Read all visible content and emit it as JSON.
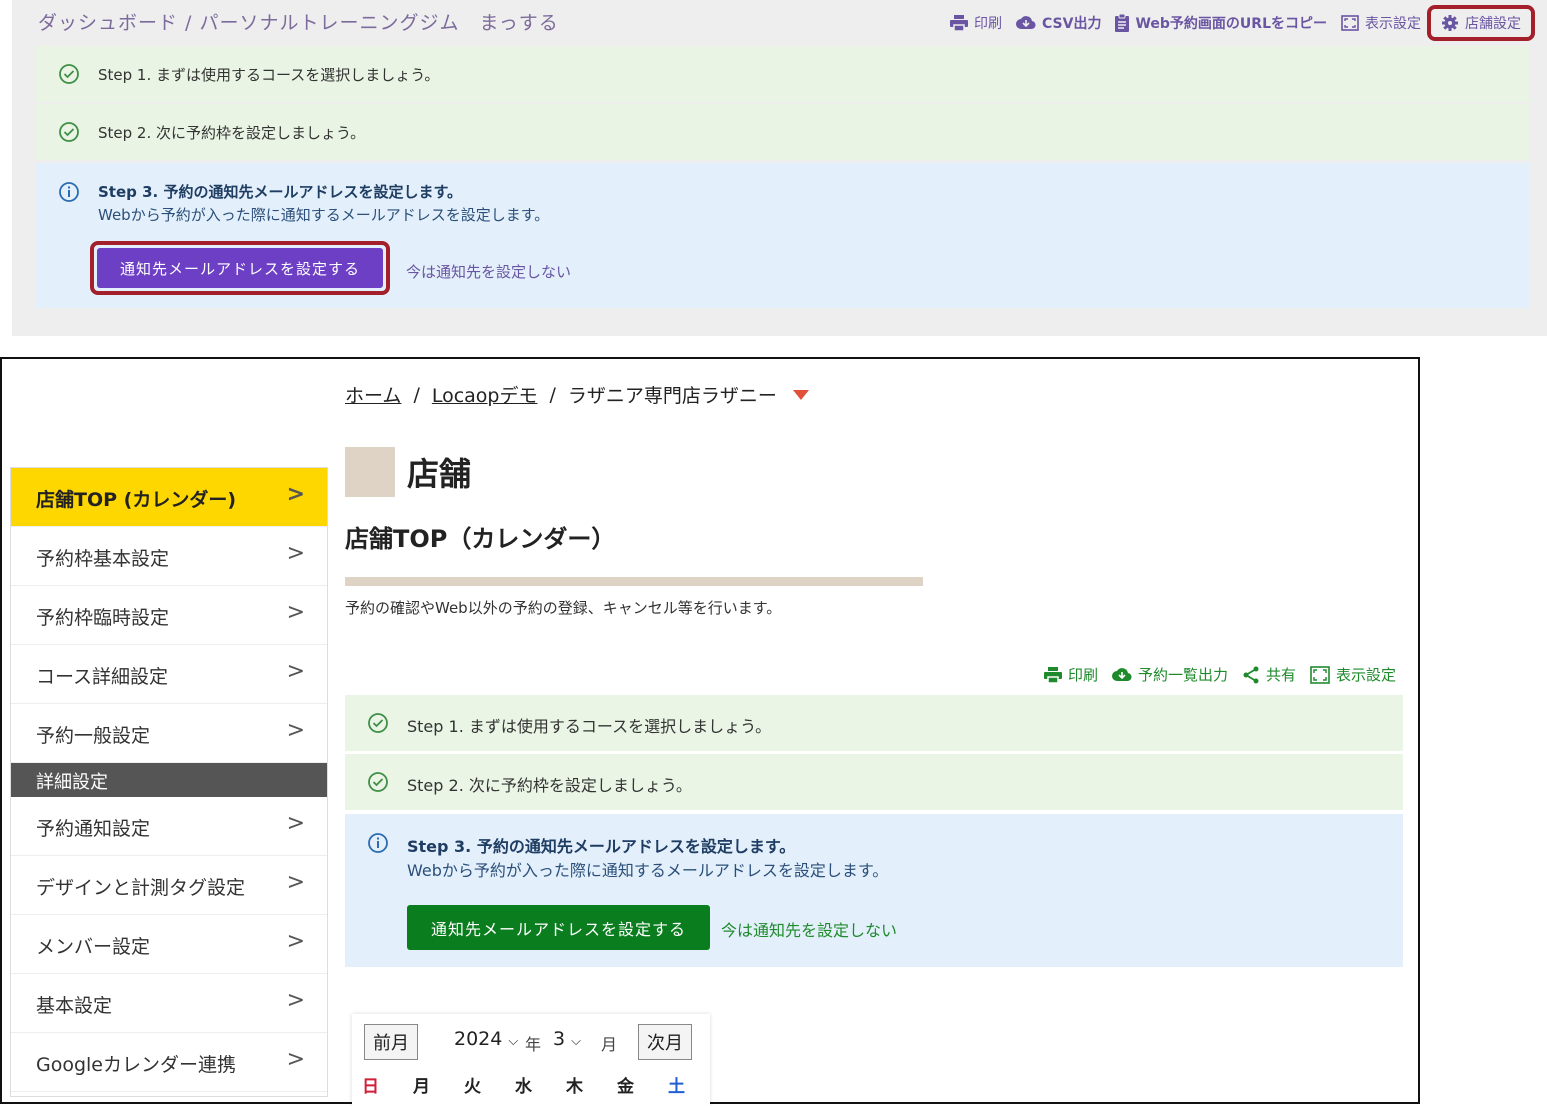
{
  "top_panel": {
    "breadcrumb": "ダッシュボード / パーソナルトレーニングジム　まっする",
    "toolbar": {
      "print": "印刷",
      "csv": "CSV出力",
      "web_url": "Web予約画面のURLをコピー",
      "display": "表示設定",
      "shop_settings": "店舗設定"
    },
    "steps": {
      "step1": "Step 1. まずは使用するコースを選択しましょう。",
      "step2": "Step 2. 次に予約枠を設定しましょう。",
      "step3_title": "Step 3. 予約の通知先メールアドレスを設定します。",
      "step3_desc": "Webから予約が入った際に通知するメールアドレスを設定します。",
      "set_button": "通知先メールアドレスを設定する",
      "skip_link": "今は通知先を設定しない"
    },
    "colors": {
      "accent": "#6d3fc4",
      "highlight": "#a31f2a"
    }
  },
  "main": {
    "breadcrumb": {
      "home": "ホーム",
      "sep": "/",
      "company": "Locaopデモ",
      "shop": "ラザニア専門店ラザニー"
    },
    "sidebar": {
      "items": [
        {
          "label": "店舗TOP (カレンダー)"
        },
        {
          "label": "予約枠基本設定"
        },
        {
          "label": "予約枠臨時設定"
        },
        {
          "label": "コース詳細設定"
        },
        {
          "label": "予約一般設定"
        }
      ],
      "section_header": "詳細設定",
      "detail_items": [
        {
          "label": "予約通知設定"
        },
        {
          "label": "デザインと計測タグ設定"
        },
        {
          "label": "メンバー設定"
        },
        {
          "label": "基本設定"
        },
        {
          "label": "Googleカレンダー連携"
        }
      ],
      "chevron": ">"
    },
    "page_title": "店舗",
    "subtitle": "店舗TOP（カレンダー）",
    "description": "予約の確認やWeb以外の予約の登録、キャンセル等を行います。",
    "toolbar": {
      "print": "印刷",
      "export": "予約一覧出力",
      "share": "共有",
      "display": "表示設定"
    },
    "steps": {
      "step1": "Step 1. まずは使用するコースを選択しましょう。",
      "step2": "Step 2. 次に予約枠を設定しましょう。",
      "step3_title": "Step 3. 予約の通知先メールアドレスを設定します。",
      "step3_desc": "Webから予約が入った際に通知するメールアドレスを設定します。",
      "set_button": "通知先メールアドレスを設定する",
      "skip_link": "今は通知先を設定しない"
    },
    "calendar": {
      "prev": "前月",
      "next": "次月",
      "year": "2024",
      "year_unit": "年",
      "month": "3",
      "month_unit": "月",
      "weekdays": [
        "日",
        "月",
        "火",
        "水",
        "木",
        "金",
        "土"
      ]
    },
    "colors": {
      "accent": "#0a7d1e",
      "nav_active": "#ffd700",
      "brand_tan": "#ded3c5"
    }
  }
}
